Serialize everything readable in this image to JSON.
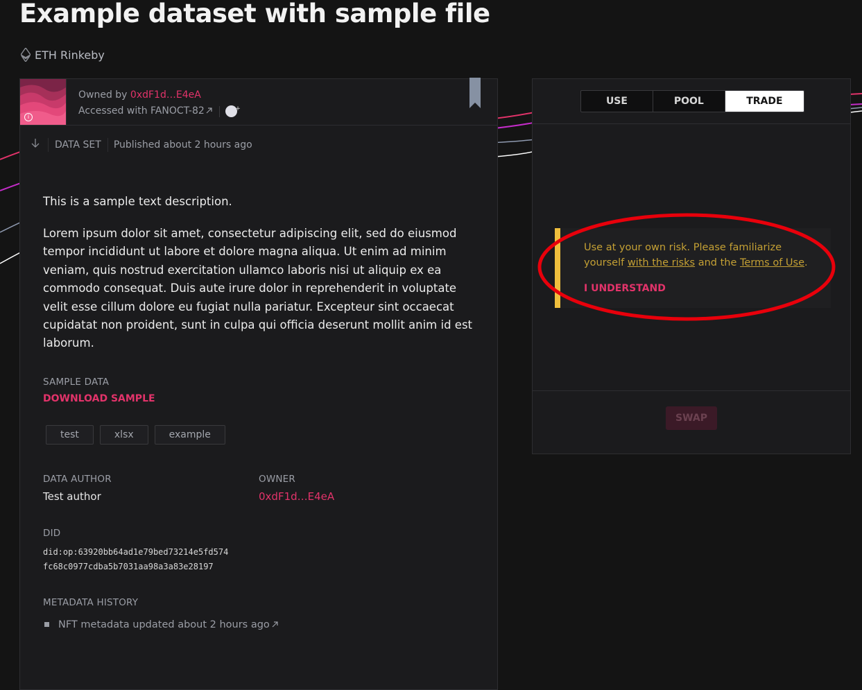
{
  "page": {
    "title": "Example dataset with sample file",
    "network": "ETH Rinkeby"
  },
  "asset": {
    "owned_by_label": "Owned by",
    "owner_address": "0xdF1d…E4eA",
    "accessed_with": "Accessed with FANOCT-82",
    "type": "DATA SET",
    "published": "Published about 2 hours ago",
    "description_short": "This is a sample text description.",
    "description_long": "Lorem ipsum dolor sit amet, consectetur adipiscing elit, sed do eiusmod tempor incididunt ut labore et dolore magna aliqua. Ut enim ad minim veniam, quis nostrud exercitation ullamco laboris nisi ut aliquip ex ea commodo consequat. Duis aute irure dolor in reprehenderit in voluptate velit esse cillum dolore eu fugiat nulla pariatur. Excepteur sint occaecat cupidatat non proident, sunt in culpa qui officia deserunt mollit anim id est laborum.",
    "sample_label": "SAMPLE DATA",
    "download_label": "DOWNLOAD SAMPLE",
    "tags": [
      "test",
      "xlsx",
      "example"
    ],
    "author_label": "DATA AUTHOR",
    "author": "Test author",
    "owner_label": "OWNER",
    "owner": "0xdF1d…E4eA",
    "did_label": "DID",
    "did_line1": "did:op:63920bb64ad1e79bed73214e5fd574",
    "did_line2": "fc68c0977cdba5b7031aa98a3a83e28197",
    "history_label": "METADATA HISTORY",
    "history_item": "NFT metadata updated about 2 hours ago"
  },
  "trade": {
    "tabs": [
      "USE",
      "POOL",
      "TRADE"
    ],
    "active_tab": "TRADE",
    "warning_prefix": "Use at your own risk. Please familiarize yourself ",
    "warning_link1": "with the risks",
    "warning_mid": " and the ",
    "warning_link2": "Terms of Use",
    "warning_suffix": ".",
    "understand_label": "I UNDERSTAND",
    "swap_label": "SWAP"
  },
  "colors": {
    "accent_pink": "#e2336a",
    "warning_yellow": "#efbe3d",
    "annotation_red": "#e8000b",
    "background": "#141414"
  },
  "icons": [
    "ethereum-icon",
    "external-link-icon",
    "nft-badge-icon",
    "bookmark-icon",
    "arrow-down-icon",
    "info-icon",
    "bullet-icon"
  ]
}
